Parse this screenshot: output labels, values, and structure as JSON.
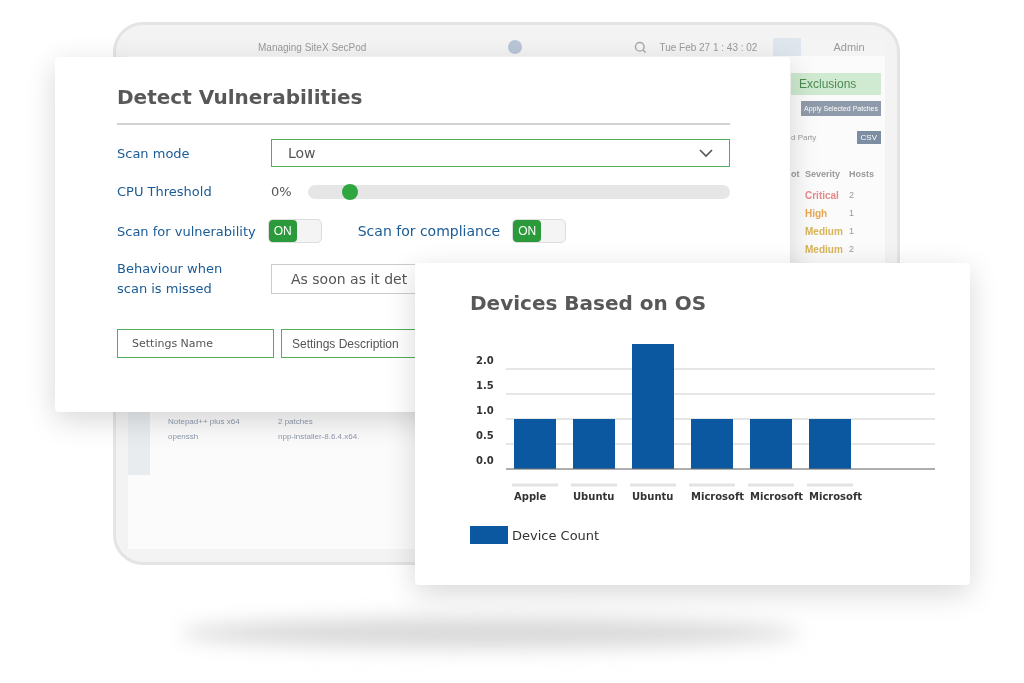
{
  "tablet": {
    "managing": "Managing SiteX SecPod",
    "clock": "Tue Feb 27 1 : 43 : 02",
    "user": "Admin",
    "exclusions": "Exclusions",
    "apply_button": "Apply Selected Patches",
    "filter_partial": "d Party",
    "csv_button": "CSV",
    "columns": [
      "ot",
      "Severity",
      "Hosts"
    ],
    "rows": [
      {
        "severity": "Critical",
        "hosts": "2",
        "color": "#e58a8a"
      },
      {
        "severity": "High",
        "hosts": "1",
        "color": "#e9a94f"
      },
      {
        "severity": "Medium",
        "hosts": "1",
        "color": "#d9b55a"
      },
      {
        "severity": "Medium",
        "hosts": "2",
        "color": "#d9b55a"
      }
    ],
    "patch_rows": [
      {
        "name": "Notepad++ plus x64",
        "detail": "2 patches"
      },
      {
        "name": "openssh",
        "detail": "npp-installer-8.6.4.x64."
      }
    ]
  },
  "settings": {
    "title": "Detect Vulnerabilities",
    "scan_mode": {
      "label": "Scan mode",
      "value": "Low"
    },
    "cpu": {
      "label": "CPU Threshold",
      "reading": "0%",
      "level": 0.1
    },
    "toggles": [
      {
        "label": "Scan for vulnerability",
        "state_label": "ON",
        "on": true
      },
      {
        "label": "Scan for compliance",
        "state_label": "ON",
        "on": true
      }
    ],
    "behaviour": {
      "label": "Behaviour when scan is missed",
      "value": "As soon as it det"
    },
    "fields": [
      {
        "placeholder": "Settings Name"
      },
      {
        "placeholder": "Settings Description"
      }
    ]
  },
  "devices_card": {
    "title": "Devices Based on OS",
    "chart_data": {
      "type": "bar",
      "grid": true,
      "categories": [
        "Apple",
        "Ubuntu",
        "Ubuntu",
        "Microsoft",
        "Microsoft",
        "Microsoft"
      ],
      "ylim": [
        0,
        2.5
      ],
      "yticks": [
        {
          "value": 0,
          "label": "0.0"
        },
        {
          "value": 0.5,
          "label": "0.5"
        },
        {
          "value": 1,
          "label": "1.0"
        },
        {
          "value": 1.5,
          "label": "1.5"
        },
        {
          "value": 2,
          "label": "2.0"
        }
      ],
      "series": [
        {
          "name": "Device Count",
          "color": "#0b57a0",
          "values": [
            1,
            1,
            2.5,
            1,
            1,
            1
          ]
        }
      ]
    }
  }
}
